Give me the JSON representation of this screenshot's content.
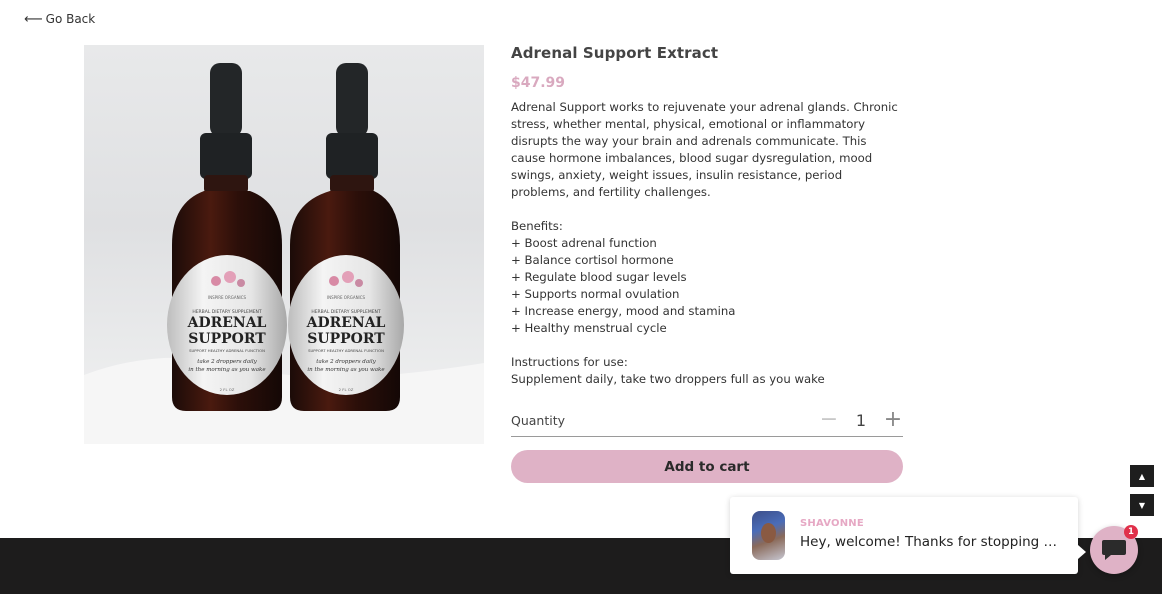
{
  "nav": {
    "go_back_label": "Go Back",
    "go_back_icon": "arrow-left-icon"
  },
  "product": {
    "name": "Adrenal Support Extract",
    "price": "$47.99",
    "image": {
      "brand": "INSPIRE ORGANICS",
      "kicker": "HERBAL DIETARY SUPPLEMENT",
      "line1": "ADRENAL",
      "line2": "SUPPORT",
      "tagline": "SUPPORT HEALTHY ADRENAL FUNCTION",
      "dose1": "take 2 droppers daily",
      "dose2": "in the morning as you wake",
      "volume": "2 FL OZ"
    },
    "description": "Adrenal Support works to rejuvenate your adrenal glands. Chronic stress, whether mental, physical, emotional or inflammatory disrupts the way your brain and adrenals communicate. This cause hormone imbalances, blood sugar dysregulation, mood swings, anxiety, weight issues, insulin resistance, period problems, and fertility challenges.",
    "benefits_title": "Benefits:",
    "benefits": [
      "+ Boost adrenal function",
      "+ Balance cortisol hormone",
      "+ Regulate blood sugar levels",
      "+ Supports normal ovulation",
      "+ Increase energy, mood and stamina",
      "+ Healthy menstrual cycle"
    ],
    "instructions_title": "Instructions for use:",
    "instructions": "Supplement daily, take two droppers full as you wake"
  },
  "quantity": {
    "label": "Quantity",
    "value": "1",
    "minus": "−",
    "plus": "+"
  },
  "cart": {
    "add_label": "Add to cart"
  },
  "scroll": {
    "up": "▲",
    "down": "▼"
  },
  "chat": {
    "agent_name": "SHAVONNE",
    "message": "Hey, welcome! Thanks for stopping by!",
    "unread_count": "1"
  },
  "colors": {
    "accent_pink": "#dfb2c6",
    "price_pink": "#d9a9bf",
    "name_pink": "#e6a8c4",
    "footer": "#1d1c1c",
    "badge_red": "#e0304a"
  }
}
